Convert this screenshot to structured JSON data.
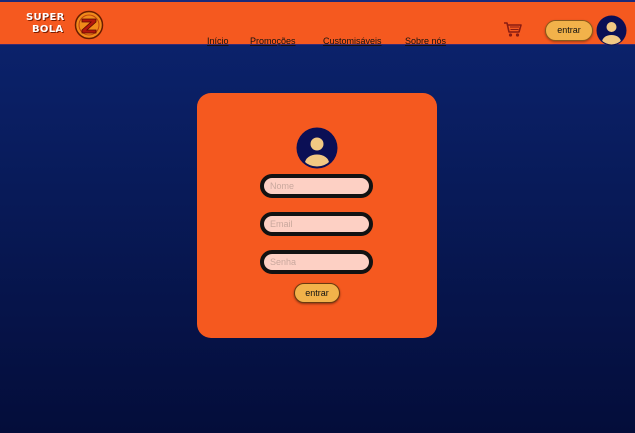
{
  "brand": {
    "line1": "SUPER",
    "line2": "BOLA",
    "ball_icon": "dragon-ball-z-logo-icon"
  },
  "nav": {
    "items": [
      {
        "label": "Início"
      },
      {
        "label": "Promoções"
      },
      {
        "label": "Customisáveis"
      },
      {
        "label": "Sobre nós"
      }
    ]
  },
  "header": {
    "cart_icon": "cart-icon",
    "login_label": "entrar",
    "avatar_icon": "user-avatar-icon"
  },
  "form": {
    "avatar_icon": "user-avatar-icon",
    "name_placeholder": "Nome",
    "email_placeholder": "Email",
    "password_placeholder": "Senha",
    "submit_label": "entrar"
  },
  "colors": {
    "orange": "#f5591f",
    "navy": "#0c1f66",
    "button": "#f2b24a",
    "input_bg": "#fdd0c4"
  }
}
